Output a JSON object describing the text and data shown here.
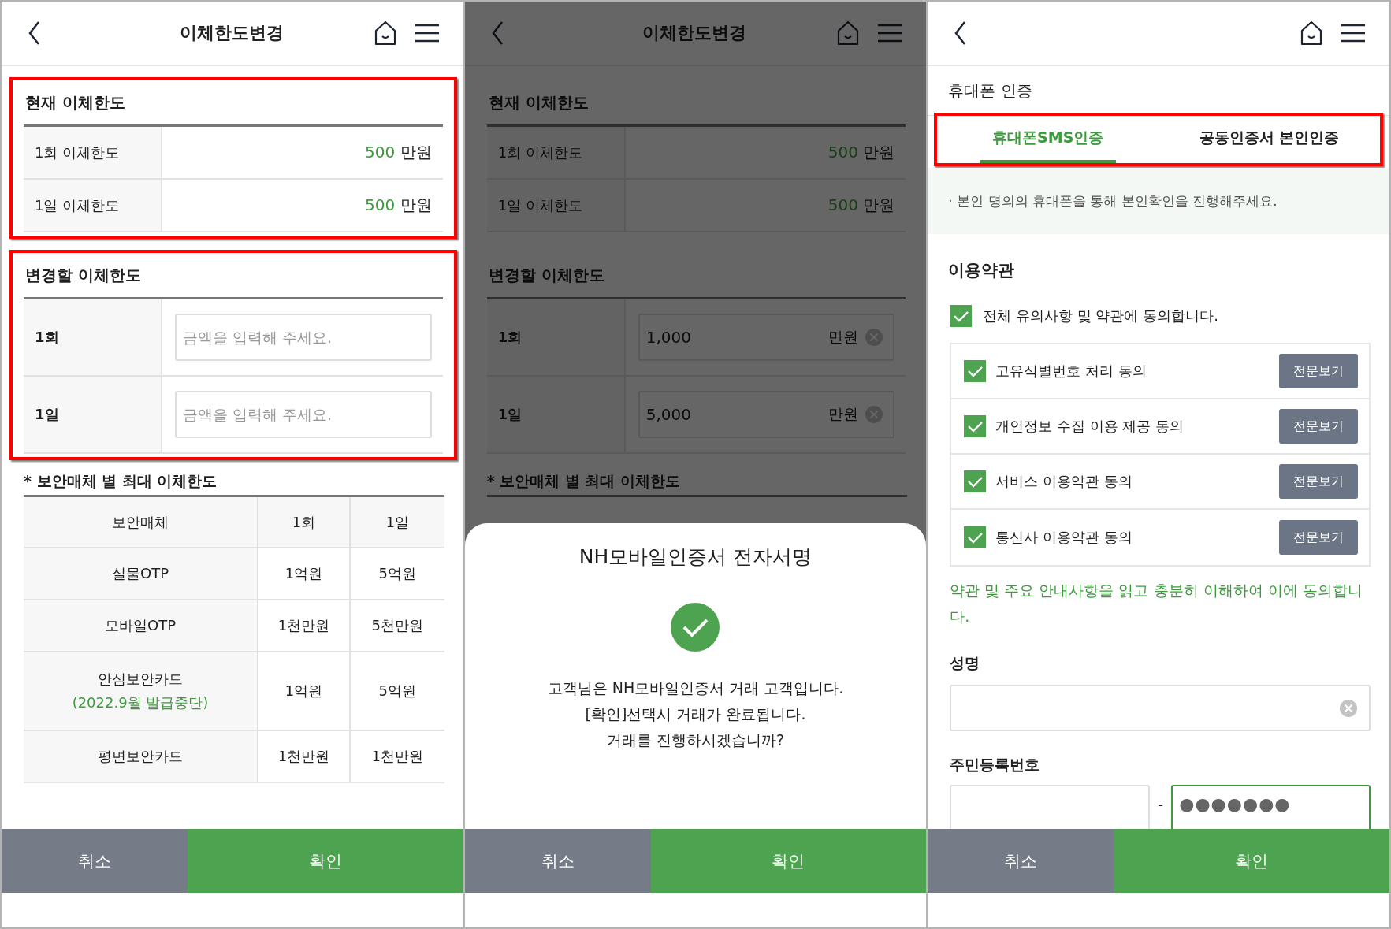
{
  "screens": [
    {
      "kind": "limits",
      "header": {
        "title": "이체한도변경"
      },
      "current": {
        "title": "현재 이체한도",
        "highlighted": true,
        "rows": [
          {
            "label": "1회 이체한도",
            "amount": "500",
            "unit": "만원"
          },
          {
            "label": "1일 이체한도",
            "amount": "500",
            "unit": "만원"
          }
        ]
      },
      "change": {
        "title": "변경할 이체한도",
        "highlighted": true,
        "rows": [
          {
            "label": "1회",
            "placeholder": "금액을 입력해 주세요."
          },
          {
            "label": "1일",
            "placeholder": "금액을 입력해 주세요."
          }
        ]
      },
      "max_table": {
        "title": "* 보안매체 별 최대 이체한도",
        "columns": [
          "보안매체",
          "1회",
          "1일"
        ],
        "rows": [
          {
            "cells": [
              "실물OTP",
              "1억원",
              "5억원"
            ]
          },
          {
            "cells": [
              "모바일OTP",
              "1천만원",
              "5천만원"
            ]
          },
          {
            "cells": [
              "안심보안카드",
              "1억원",
              "5억원"
            ],
            "note": "(2022.9월 발급중단)"
          },
          {
            "cells": [
              "평면보안카드",
              "1천만원",
              "1천만원"
            ]
          }
        ]
      },
      "buttons": {
        "cancel": "취소",
        "confirm": "확인"
      }
    },
    {
      "kind": "limits",
      "dimmed": true,
      "header": {
        "title": "이체한도변경"
      },
      "current": {
        "title": "현재 이체한도",
        "rows": [
          {
            "label": "1회 이체한도",
            "amount": "500",
            "unit": "만원"
          },
          {
            "label": "1일 이체한도",
            "amount": "500",
            "unit": "만원"
          }
        ]
      },
      "change": {
        "title": "변경할 이체한도",
        "rows": [
          {
            "label": "1회",
            "value": "1,000",
            "unit": "만원"
          },
          {
            "label": "1일",
            "value": "5,000",
            "unit": "만원"
          }
        ]
      },
      "max_table": {
        "title": "* 보안매체 별 최대 이체한도"
      },
      "sheet": {
        "title": "NH모바일인증서 전자서명",
        "message": [
          "고객님은 NH모바일인증서 거래 고객입니다.",
          "[확인]선택시 거래가 완료됩니다.",
          "거래를 진행하시겠습니까?"
        ],
        "buttons": {
          "cancel": "취소",
          "confirm": "확인"
        }
      }
    },
    {
      "kind": "phone_auth",
      "section_title": "휴대폰 인증",
      "tabs": {
        "highlighted": true,
        "items": [
          {
            "label": "휴대폰SMS인증",
            "selected": true
          },
          {
            "label": "공동인증서 본인인증",
            "selected": false
          }
        ]
      },
      "notice": "· 본인 명의의 휴대폰을 통해 본인확인을 진행해주세요.",
      "terms": {
        "title": "이용약관",
        "agree_all": {
          "label": "전체 유의사항 및 약관에 동의합니다.",
          "checked": true
        },
        "items": [
          {
            "label": "고유식별번호 처리 동의",
            "checked": true,
            "button": "전문보기"
          },
          {
            "label": "개인정보 수집 이용 제공 동의",
            "checked": true,
            "button": "전문보기"
          },
          {
            "label": "서비스 이용약관 동의",
            "checked": true,
            "button": "전문보기"
          },
          {
            "label": "통신사 이용약관 동의",
            "checked": true,
            "button": "전문보기"
          }
        ],
        "note": "약관 및 주요 안내사항을 읽고 충분히 이해하여 이에 동의합니다."
      },
      "name_field": {
        "label": "성명"
      },
      "id_field": {
        "label": "주민등록번호",
        "separator": "-",
        "back_value": "●●●●●●●",
        "back_focused": true
      },
      "buttons": {
        "cancel": "취소",
        "confirm": "확인"
      }
    }
  ]
}
